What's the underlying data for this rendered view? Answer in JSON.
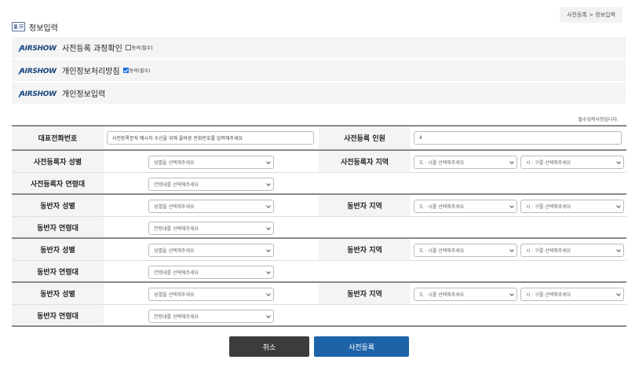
{
  "breadcrumb": "사전등록 > 정보입력",
  "page_title": "정보입력",
  "logo_text": "AIRSHOW",
  "consent": [
    {
      "label": "사전등록 과정확인",
      "checkbox_label": "동의(필수)",
      "checked": false
    },
    {
      "label": "개인정보처리방침",
      "checkbox_label": "동의(필수)",
      "checked": true
    },
    {
      "label": "개인정보입력"
    }
  ],
  "required_note": "필수입력사항입니다.",
  "form": {
    "phone_label": "대표전화번호",
    "phone_value": "사전등록문자 메시지 수신을 위해 올바른 전화번호를 입력해주세요",
    "count_label": "사전등록 인원",
    "count_value": "4",
    "reg_gender_label": "사전등록자 성별",
    "reg_region_label": "사전등록자 지역",
    "reg_age_label": "사전등록자 연령대",
    "comp_gender_label": "동반자 성별",
    "comp_region_label": "동반자 지역",
    "comp_age_label": "동반자 연령대",
    "gender_ph": "성별을 선택해주세요",
    "age_ph": "연령대를 선택해주세요",
    "province_ph": "도 · 시를 선택해주세요",
    "city_ph": "시 · 구를 선택해주세요"
  },
  "buttons": {
    "cancel": "취소",
    "submit": "사전등록"
  }
}
